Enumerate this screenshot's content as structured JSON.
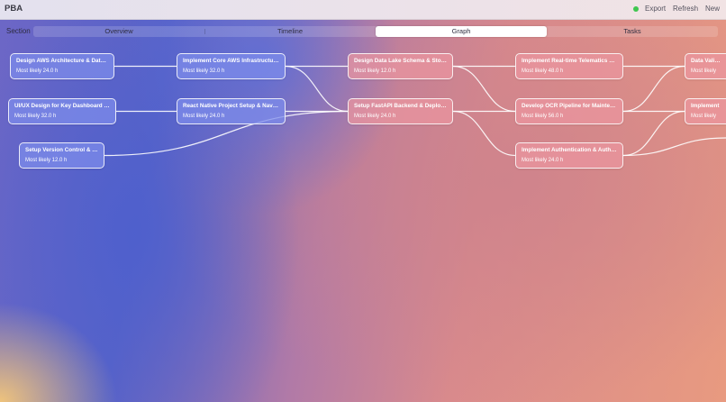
{
  "app": {
    "name": "PBA"
  },
  "toolbar": {
    "export_label": "Export",
    "refresh_label": "Refresh",
    "new_label": "New",
    "status_color": "#3fc64f"
  },
  "section": {
    "label": "Section",
    "tabs": [
      {
        "label": "Overview",
        "active": false
      },
      {
        "label": "Timeline",
        "active": false
      },
      {
        "label": "Graph",
        "active": true
      },
      {
        "label": "Tasks",
        "active": false
      }
    ]
  },
  "graph": {
    "nodes": [
      {
        "id": "n1",
        "title": "Design AWS Architecture & Data Flow",
        "estimate": "Most likely 24.0 h",
        "color": "blue"
      },
      {
        "id": "n2",
        "title": "UI/UX Design for Key Dashboard Scre...",
        "estimate": "Most likely 32.0 h",
        "color": "blue"
      },
      {
        "id": "n3",
        "title": "Setup Version Control & CI/CD",
        "estimate": "Most likely 12.0 h",
        "color": "blue"
      },
      {
        "id": "n4",
        "title": "Implement Core AWS Infrastructure w...",
        "estimate": "Most likely 32.0 h",
        "color": "blue"
      },
      {
        "id": "n5",
        "title": "React Native Project Setup & Navigati...",
        "estimate": "Most likely 24.0 h",
        "color": "blue"
      },
      {
        "id": "n6",
        "title": "Design Data Lake Schema & Storage...",
        "estimate": "Most likely 12.0 h",
        "color": "pink"
      },
      {
        "id": "n7",
        "title": "Setup FastAPI Backend & Deployment",
        "estimate": "Most likely 24.0 h",
        "color": "pink"
      },
      {
        "id": "n8",
        "title": "Implement Real-time Telematics & Se...",
        "estimate": "Most likely 48.0 h",
        "color": "pink"
      },
      {
        "id": "n9",
        "title": "Develop OCR Pipeline for Maintenanc...",
        "estimate": "Most likely 56.0 h",
        "color": "pink"
      },
      {
        "id": "n10",
        "title": "Implement Authentication & Authoriz...",
        "estimate": "Most likely 24.0 h",
        "color": "pink"
      },
      {
        "id": "n11",
        "title": "Data Valida",
        "estimate": "Most likely",
        "color": "pink"
      },
      {
        "id": "n12",
        "title": "Implement",
        "estimate": "Most likely",
        "color": "pink"
      }
    ],
    "edges": [
      [
        "n1",
        "n4"
      ],
      [
        "n2",
        "n5"
      ],
      [
        "n3",
        "n7"
      ],
      [
        "n4",
        "n6"
      ],
      [
        "n4",
        "n7"
      ],
      [
        "n5",
        "n7"
      ],
      [
        "n6",
        "n8"
      ],
      [
        "n6",
        "n9"
      ],
      [
        "n7",
        "n9"
      ],
      [
        "n7",
        "n10"
      ],
      [
        "n8",
        "n11"
      ],
      [
        "n9",
        "n11"
      ],
      [
        "n9",
        "n12"
      ],
      [
        "n10",
        "n12"
      ],
      [
        "n10",
        "offscreen"
      ]
    ]
  }
}
